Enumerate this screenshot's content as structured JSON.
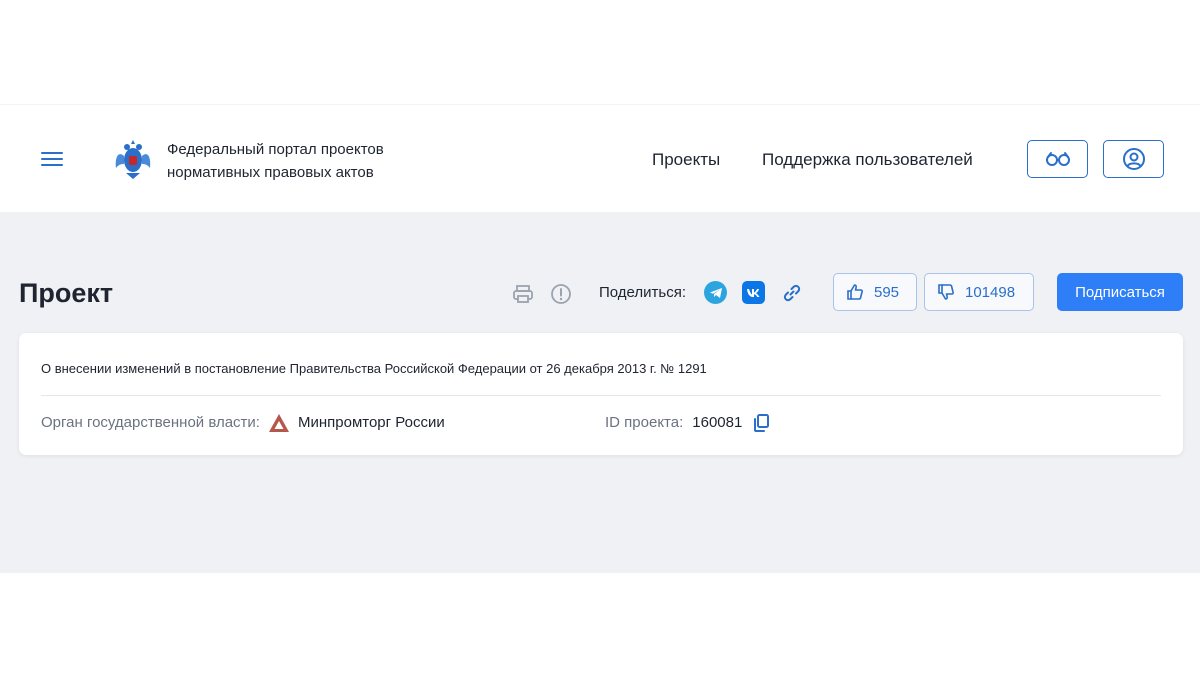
{
  "header": {
    "portal_title_line1": "Федеральный портал проектов",
    "portal_title_line2": "нормативных правовых актов",
    "nav": {
      "projects": "Проекты",
      "support": "Поддержка пользователей"
    },
    "icons": {
      "menu": "hamburger-menu-icon",
      "emblem": "russian-eagle-emblem",
      "vision": "glasses-icon",
      "account": "user-circle-icon"
    }
  },
  "page": {
    "title": "Проект",
    "share_label": "Поделиться:",
    "likes": "595",
    "dislikes": "101498",
    "subscribe_label": "Подписаться"
  },
  "card": {
    "title": "О внесении изменений в постановление Правительства Российской Федерации от 26 декабря 2013 г. № 1291",
    "authority_label": "Орган государственной власти:",
    "authority_value": "Минпромторг России",
    "project_id_label": "ID проекта:",
    "project_id_value": "160081"
  },
  "colors": {
    "accent": "#2a6fc9",
    "primary_button": "#2d7ef7",
    "background_main": "#eff1f4",
    "telegram": "#2ba4e0",
    "vk": "#0b77e6",
    "ministry_logo": "#b5574a"
  }
}
